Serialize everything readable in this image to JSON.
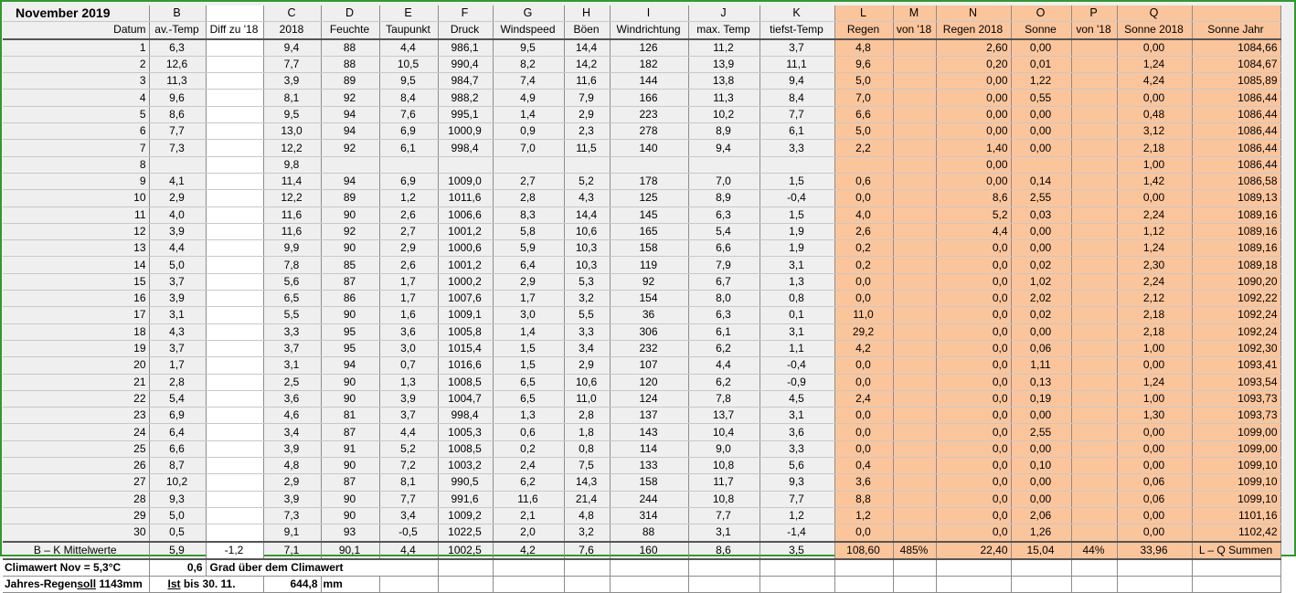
{
  "title": "November 2019",
  "column_letters": [
    "B",
    "",
    "C",
    "D",
    "E",
    "F",
    "G",
    "H",
    "I",
    "J",
    "K",
    "L",
    "M",
    "N",
    "O",
    "P",
    "Q",
    ""
  ],
  "headers": [
    "av.-Temp",
    "Diff zu '18",
    "2018",
    "Feuchte",
    "Taupunkt",
    "Druck",
    "Windspeed",
    "Böen",
    "Windrichtung",
    "max. Temp",
    "tiefst-Temp",
    "Regen",
    "von '18",
    "Regen 2018",
    "Sonne",
    "von '18",
    "Sonne 2018",
    "Sonne Jahr"
  ],
  "datum_label": "Datum",
  "rows": [
    [
      "1",
      "6,3",
      "",
      "9,4",
      "88",
      "4,4",
      "986,1",
      "9,5",
      "14,4",
      "126",
      "11,2",
      "3,7",
      "4,8",
      "",
      "2,60",
      "0,00",
      "",
      "0,00",
      "1084,66"
    ],
    [
      "2",
      "12,6",
      "",
      "7,7",
      "88",
      "10,5",
      "990,4",
      "8,2",
      "14,2",
      "182",
      "13,9",
      "11,1",
      "9,6",
      "",
      "0,20",
      "0,01",
      "",
      "1,24",
      "1084,67"
    ],
    [
      "3",
      "11,3",
      "",
      "3,9",
      "89",
      "9,5",
      "984,7",
      "7,4",
      "11,6",
      "144",
      "13,8",
      "9,4",
      "5,0",
      "",
      "0,00",
      "1,22",
      "",
      "4,24",
      "1085,89"
    ],
    [
      "4",
      "9,6",
      "",
      "8,1",
      "92",
      "8,4",
      "988,2",
      "4,9",
      "7,9",
      "166",
      "11,3",
      "8,4",
      "7,0",
      "",
      "0,00",
      "0,55",
      "",
      "0,00",
      "1086,44"
    ],
    [
      "5",
      "8,6",
      "",
      "9,5",
      "94",
      "7,6",
      "995,1",
      "1,4",
      "2,9",
      "223",
      "10,2",
      "7,7",
      "6,6",
      "",
      "0,00",
      "0,00",
      "",
      "0,48",
      "1086,44"
    ],
    [
      "6",
      "7,7",
      "",
      "13,0",
      "94",
      "6,9",
      "1000,9",
      "0,9",
      "2,3",
      "278",
      "8,9",
      "6,1",
      "5,0",
      "",
      "0,00",
      "0,00",
      "",
      "3,12",
      "1086,44"
    ],
    [
      "7",
      "7,3",
      "",
      "12,2",
      "92",
      "6,1",
      "998,4",
      "7,0",
      "11,5",
      "140",
      "9,4",
      "3,3",
      "2,2",
      "",
      "1,40",
      "0,00",
      "",
      "2,18",
      "1086,44"
    ],
    [
      "8",
      "",
      "",
      "9,8",
      "",
      "",
      "",
      "",
      "",
      "",
      "",
      "",
      "",
      "",
      "0,00",
      "",
      "",
      "1,00",
      "1086,44"
    ],
    [
      "9",
      "4,1",
      "",
      "11,4",
      "94",
      "6,9",
      "1009,0",
      "2,7",
      "5,2",
      "178",
      "7,0",
      "1,5",
      "0,6",
      "",
      "0,00",
      "0,14",
      "",
      "1,42",
      "1086,58"
    ],
    [
      "10",
      "2,9",
      "",
      "12,2",
      "89",
      "1,2",
      "1011,6",
      "2,8",
      "4,3",
      "125",
      "8,9",
      "-0,4",
      "0,0",
      "",
      "8,6",
      "2,55",
      "",
      "0,00",
      "1089,13"
    ],
    [
      "11",
      "4,0",
      "",
      "11,6",
      "90",
      "2,6",
      "1006,6",
      "8,3",
      "14,4",
      "145",
      "6,3",
      "1,5",
      "4,0",
      "",
      "5,2",
      "0,03",
      "",
      "2,24",
      "1089,16"
    ],
    [
      "12",
      "3,9",
      "",
      "11,6",
      "92",
      "2,7",
      "1001,2",
      "5,8",
      "10,6",
      "165",
      "5,4",
      "1,9",
      "2,6",
      "",
      "4,4",
      "0,00",
      "",
      "1,12",
      "1089,16"
    ],
    [
      "13",
      "4,4",
      "",
      "9,9",
      "90",
      "2,9",
      "1000,6",
      "5,9",
      "10,3",
      "158",
      "6,6",
      "1,9",
      "0,2",
      "",
      "0,0",
      "0,00",
      "",
      "1,24",
      "1089,16"
    ],
    [
      "14",
      "5,0",
      "",
      "7,8",
      "85",
      "2,6",
      "1001,2",
      "6,4",
      "10,3",
      "119",
      "7,9",
      "3,1",
      "0,2",
      "",
      "0,0",
      "0,02",
      "",
      "2,30",
      "1089,18"
    ],
    [
      "15",
      "3,7",
      "",
      "5,6",
      "87",
      "1,7",
      "1000,2",
      "2,9",
      "5,3",
      "92",
      "6,7",
      "1,3",
      "0,0",
      "",
      "0,0",
      "1,02",
      "",
      "2,24",
      "1090,20"
    ],
    [
      "16",
      "3,9",
      "",
      "6,5",
      "86",
      "1,7",
      "1007,6",
      "1,7",
      "3,2",
      "154",
      "8,0",
      "0,8",
      "0,0",
      "",
      "0,0",
      "2,02",
      "",
      "2,12",
      "1092,22"
    ],
    [
      "17",
      "3,1",
      "",
      "5,5",
      "90",
      "1,6",
      "1009,1",
      "3,0",
      "5,5",
      "36",
      "6,3",
      "0,1",
      "11,0",
      "",
      "0,0",
      "0,02",
      "",
      "2,18",
      "1092,24"
    ],
    [
      "18",
      "4,3",
      "",
      "3,3",
      "95",
      "3,6",
      "1005,8",
      "1,4",
      "3,3",
      "306",
      "6,1",
      "3,1",
      "29,2",
      "",
      "0,0",
      "0,00",
      "",
      "2,18",
      "1092,24"
    ],
    [
      "19",
      "3,7",
      "",
      "3,7",
      "95",
      "3,0",
      "1015,4",
      "1,5",
      "3,4",
      "232",
      "6,2",
      "1,1",
      "4,2",
      "",
      "0,0",
      "0,06",
      "",
      "1,00",
      "1092,30"
    ],
    [
      "20",
      "1,7",
      "",
      "3,1",
      "94",
      "0,7",
      "1016,6",
      "1,5",
      "2,9",
      "107",
      "4,4",
      "-0,4",
      "0,0",
      "",
      "0,0",
      "1,11",
      "",
      "0,00",
      "1093,41"
    ],
    [
      "21",
      "2,8",
      "",
      "2,5",
      "90",
      "1,3",
      "1008,5",
      "6,5",
      "10,6",
      "120",
      "6,2",
      "-0,9",
      "0,0",
      "",
      "0,0",
      "0,13",
      "",
      "1,24",
      "1093,54"
    ],
    [
      "22",
      "5,4",
      "",
      "3,6",
      "90",
      "3,9",
      "1004,7",
      "6,5",
      "11,0",
      "124",
      "7,8",
      "4,5",
      "2,4",
      "",
      "0,0",
      "0,19",
      "",
      "1,00",
      "1093,73"
    ],
    [
      "23",
      "6,9",
      "",
      "4,6",
      "81",
      "3,7",
      "998,4",
      "1,3",
      "2,8",
      "137",
      "13,7",
      "3,1",
      "0,0",
      "",
      "0,0",
      "0,00",
      "",
      "1,30",
      "1093,73"
    ],
    [
      "24",
      "6,4",
      "",
      "3,4",
      "87",
      "4,4",
      "1005,3",
      "0,6",
      "1,8",
      "143",
      "10,4",
      "3,6",
      "0,0",
      "",
      "0,0",
      "2,55",
      "",
      "0,00",
      "1099,00"
    ],
    [
      "25",
      "6,6",
      "",
      "3,9",
      "91",
      "5,2",
      "1008,5",
      "0,2",
      "0,8",
      "114",
      "9,0",
      "3,3",
      "0,0",
      "",
      "0,0",
      "0,00",
      "",
      "0,00",
      "1099,00"
    ],
    [
      "26",
      "8,7",
      "",
      "4,8",
      "90",
      "7,2",
      "1003,2",
      "2,4",
      "7,5",
      "133",
      "10,8",
      "5,6",
      "0,4",
      "",
      "0,0",
      "0,10",
      "",
      "0,00",
      "1099,10"
    ],
    [
      "27",
      "10,2",
      "",
      "2,9",
      "87",
      "8,1",
      "990,5",
      "6,2",
      "14,3",
      "158",
      "11,7",
      "9,3",
      "3,6",
      "",
      "0,0",
      "0,00",
      "",
      "0,06",
      "1099,10"
    ],
    [
      "28",
      "9,3",
      "",
      "3,9",
      "90",
      "7,7",
      "991,6",
      "11,6",
      "21,4",
      "244",
      "10,8",
      "7,7",
      "8,8",
      "",
      "0,0",
      "0,00",
      "",
      "0,06",
      "1099,10"
    ],
    [
      "29",
      "5,0",
      "",
      "7,3",
      "90",
      "3,4",
      "1009,2",
      "2,1",
      "4,8",
      "314",
      "7,7",
      "1,2",
      "1,2",
      "",
      "0,0",
      "2,06",
      "",
      "0,00",
      "1101,16"
    ],
    [
      "30",
      "0,5",
      "",
      "9,1",
      "93",
      "-0,5",
      "1022,5",
      "2,0",
      "3,2",
      "88",
      "3,1",
      "-1,4",
      "0,0",
      "",
      "0,0",
      "1,26",
      "",
      "0,00",
      "1102,42"
    ]
  ],
  "averages": {
    "label": "B – K Mittelwerte",
    "values": [
      "5,9",
      "-1,2",
      "7,1",
      "90,1",
      "4,4",
      "1002,5",
      "4,2",
      "7,6",
      "160",
      "8,6",
      "3,5",
      "108,60",
      "485%",
      "22,40",
      "15,04",
      "44%",
      "33,96"
    ],
    "sums_label": "L – Q Summen"
  },
  "footer": {
    "climate_label": "Climawert Nov = 5,3°C",
    "climate_diff": "0,6",
    "climate_text": "Grad über dem Climawert",
    "rain_label_a": "Jahres-Regen",
    "rain_label_b": "soll",
    "rain_label_c": " 1143mm",
    "ist_a": "Ist",
    "ist_b": " bis 30. 11.",
    "rain_value": "644,8",
    "rain_unit": "mm"
  },
  "colors": {
    "orange": "#fbc59c",
    "red": "#e00000",
    "frame": "#2e9a2e"
  }
}
